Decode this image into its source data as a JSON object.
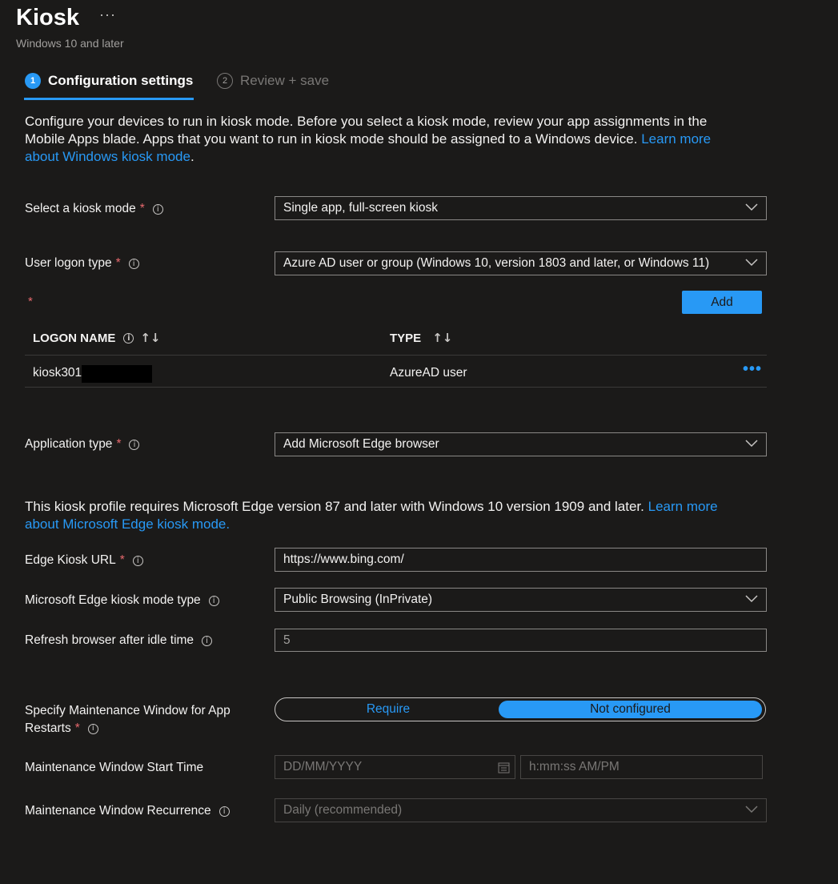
{
  "header": {
    "title": "Kiosk",
    "more": "···",
    "subtitle": "Windows 10 and later"
  },
  "steps": [
    {
      "number": "1",
      "label": "Configuration settings",
      "active": true
    },
    {
      "number": "2",
      "label": "Review + save",
      "active": false
    }
  ],
  "intro": {
    "text": "Configure your devices to run in kiosk mode. Before you select a kiosk mode, review your app assignments in the Mobile Apps blade. Apps that you want to run in kiosk mode should be assigned to a Windows device.",
    "link": "Learn more about Windows kiosk mode",
    "suffix": "."
  },
  "fields": {
    "kiosk_mode": {
      "label": "Select a kiosk mode",
      "value": "Single app, full-screen kiosk"
    },
    "logon_type": {
      "label": "User logon type",
      "value": "Azure AD user or group (Windows 10, version 1803 and later, or Windows 11)"
    },
    "app_type": {
      "label": "Application type",
      "value": "Add Microsoft Edge browser"
    },
    "edge_url": {
      "label": "Edge Kiosk URL",
      "value": "https://www.bing.com/"
    },
    "edge_mode": {
      "label": "Microsoft Edge kiosk mode type",
      "value": "Public Browsing (InPrivate)"
    },
    "refresh": {
      "label": "Refresh browser after idle time",
      "value": "5"
    },
    "maintenance": {
      "label_line1": "Specify Maintenance Window for App",
      "label_line2": "Restarts",
      "options": [
        "Require",
        "Not configured"
      ],
      "selected": "Not configured"
    },
    "start_time": {
      "label": "Maintenance Window Start Time",
      "date_placeholder": "DD/MM/YYYY",
      "time_placeholder": "h:mm:ss AM/PM"
    },
    "recurrence": {
      "label": "Maintenance Window Recurrence",
      "value": "Daily (recommended)"
    }
  },
  "required_marker": "*",
  "add_button": "Add",
  "table": {
    "headers": [
      "LOGON NAME",
      "TYPE"
    ],
    "rows": [
      {
        "name": "kiosk301",
        "type": "AzureAD user"
      }
    ]
  },
  "edge_note": {
    "text": "This kiosk profile requires Microsoft Edge version 87 and later with Windows 10 version 1909 and later.",
    "link": "Learn more about Microsoft Edge kiosk mode."
  },
  "colors": {
    "accent": "#2899f5",
    "background": "#1b1a19",
    "required": "#e8696e"
  }
}
